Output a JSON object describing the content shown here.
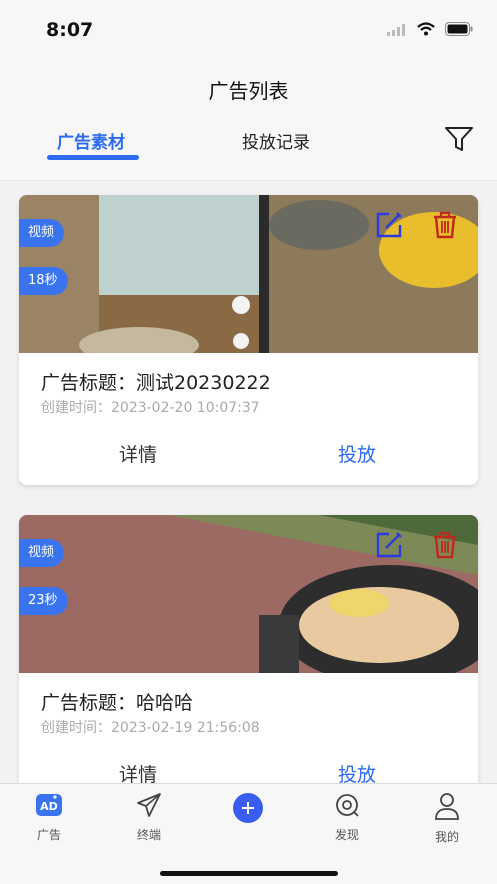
{
  "status": {
    "time": "8:07"
  },
  "header": {
    "title": "广告列表",
    "tabs": [
      {
        "label": "广告素材",
        "active": true
      },
      {
        "label": "投放记录",
        "active": false
      }
    ]
  },
  "cards": [
    {
      "type_badge": "视频",
      "duration_badge": "18秒",
      "title": "广告标题：测试20230222",
      "created": "创建时间：2023-02-20 10:07:37",
      "detail_label": "详情",
      "deploy_label": "投放"
    },
    {
      "type_badge": "视频",
      "duration_badge": "23秒",
      "title": "广告标题：哈哈哈",
      "created": "创建时间：2023-02-19 21:56:08",
      "detail_label": "详情",
      "deploy_label": "投放"
    }
  ],
  "tabbar": {
    "items": [
      {
        "label": "广告",
        "icon": "ad-icon"
      },
      {
        "label": "终端",
        "icon": "paper-plane-icon"
      },
      {
        "label": "",
        "icon": "plus-icon"
      },
      {
        "label": "发现",
        "icon": "discover-icon"
      },
      {
        "label": "我的",
        "icon": "profile-icon"
      }
    ]
  },
  "colors": {
    "accent": "#2c6bf2",
    "edit": "#2d3ae0",
    "delete": "#c0281b"
  }
}
